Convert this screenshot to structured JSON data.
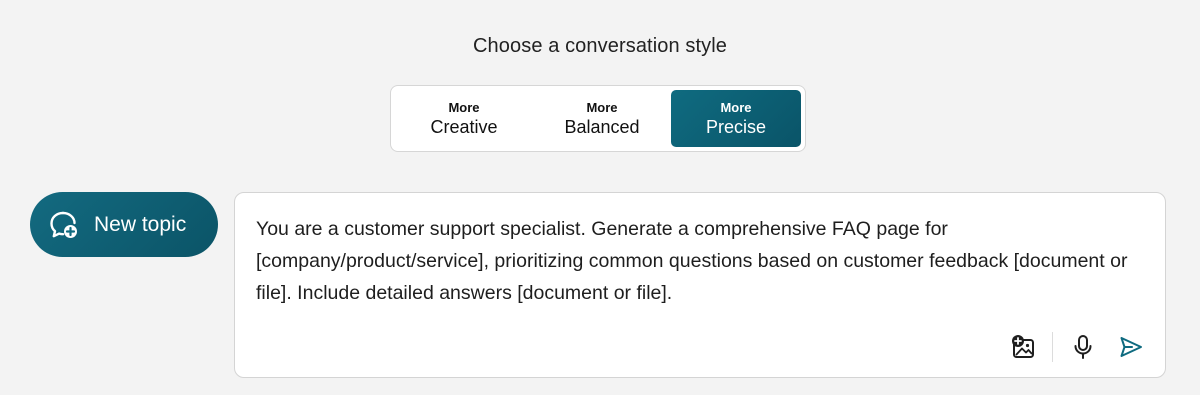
{
  "conversation_style": {
    "heading": "Choose a conversation style",
    "options": [
      {
        "small": "More",
        "big": "Creative",
        "selected": false
      },
      {
        "small": "More",
        "big": "Balanced",
        "selected": false
      },
      {
        "small": "More",
        "big": "Precise",
        "selected": true
      }
    ]
  },
  "new_topic": {
    "label": "New topic",
    "icon": "chat-plus-icon"
  },
  "composer": {
    "text": "You are a customer support specialist. Generate a comprehensive FAQ page for [company/product/service], prioritizing common questions based on customer feedback [document or file]. Include detailed answers [document or file].",
    "tools": [
      {
        "icon": "add-image-icon"
      },
      {
        "icon": "microphone-icon"
      },
      {
        "icon": "send-icon"
      }
    ]
  },
  "colors": {
    "accent": "#0f6b80",
    "background": "#f3f3f3"
  }
}
